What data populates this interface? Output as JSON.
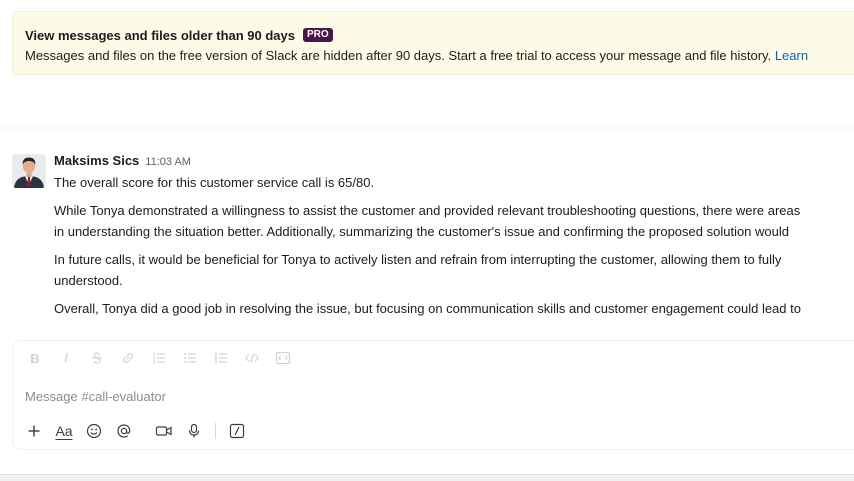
{
  "banner": {
    "title": "View messages and files older than 90 days",
    "badge": "PRO",
    "body": "Messages and files on the free version of Slack are hidden after 90 days. Start a free trial to access your message and file history. ",
    "link": "Learn"
  },
  "message": {
    "sender": "Maksims Sics",
    "timestamp": "11:03 AM",
    "lines": [
      "The overall score for this customer service call is 65/80.",
      "While Tonya demonstrated a willingness to assist the customer and provided relevant troubleshooting questions, there were areas",
      "in understanding the situation better. Additionally, summarizing the customer's issue and confirming the proposed solution would",
      "In future calls, it would be beneficial for Tonya to actively listen and refrain from interrupting the customer, allowing them to fully",
      "understood.",
      "Overall, Tonya did a good job in resolving the issue, but focusing on communication skills and customer engagement could lead to"
    ]
  },
  "composer": {
    "placeholder": "Message #call-evaluator",
    "format_labels": {
      "bold": "B",
      "italic": "I"
    },
    "aa_label": "Aa"
  }
}
